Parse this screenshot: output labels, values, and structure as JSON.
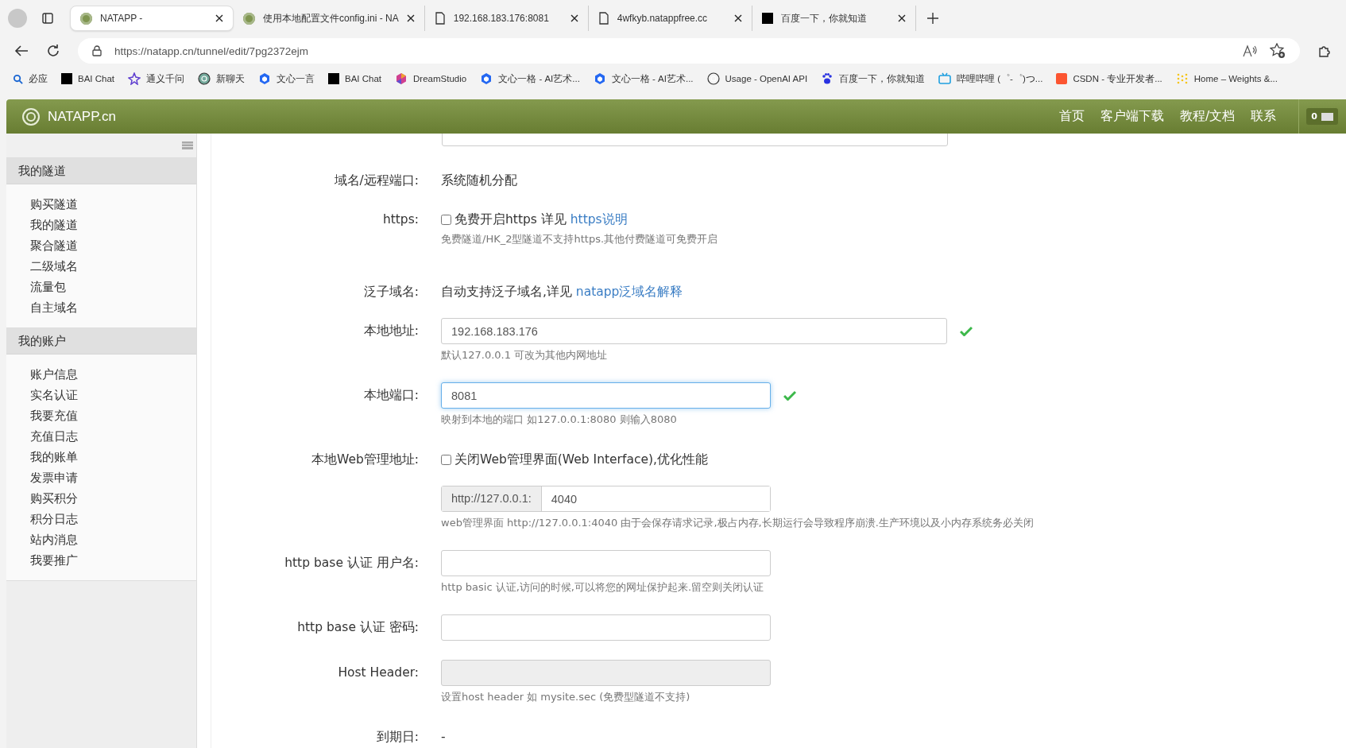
{
  "browser": {
    "tabs": [
      {
        "title": "NATAPP -",
        "selected": true
      },
      {
        "title": "使用本地配置文件config.ini - NA",
        "selected": false
      },
      {
        "title": "192.168.183.176:8081",
        "selected": false
      },
      {
        "title": "4wfkyb.natappfree.cc",
        "selected": false
      },
      {
        "title": "百度一下，你就知道",
        "selected": false
      }
    ],
    "url": "https://natapp.cn/tunnel/edit/7pg2372ejm",
    "bookmarks": [
      "必应",
      "BAI Chat",
      "通义千问",
      "新聊天",
      "文心一言",
      "BAI Chat",
      "DreamStudio",
      "文心一格 - AI艺术...",
      "文心一格 - AI艺术...",
      "Usage - OpenAI API",
      "百度一下，你就知道",
      "哔哩哔哩 (゜-゜)つ...",
      "CSDN - 专业开发者...",
      "Home – Weights &..."
    ]
  },
  "header": {
    "brand": "NATAPP.cn",
    "nav": [
      "首页",
      "客户端下载",
      "教程/文档",
      "联系"
    ],
    "mail_count": "0"
  },
  "sidebar": {
    "sections": [
      {
        "title": "我的隧道",
        "items": [
          "购买隧道",
          "我的隧道",
          "聚合隧道",
          "二级域名",
          "流量包",
          "自主域名"
        ]
      },
      {
        "title": "我的账户",
        "items": [
          "账户信息",
          "实名认证",
          "我要充值",
          "充值日志",
          "我的账单",
          "发票申请",
          "购买积分",
          "积分日志",
          "站内消息",
          "我要推广"
        ]
      }
    ]
  },
  "form": [
    {
      "kind": "text",
      "label": "域名/远程端口:",
      "text": "系统随机分配"
    },
    {
      "kind": "checkbox",
      "label": "https:",
      "text": "免费开启https 详见 ",
      "link": "https说明",
      "checked": false,
      "hint": "免费隧道/HK_2型隧道不支持https.其他付费隧道可免费开启"
    },
    {
      "kind": "text",
      "label": "泛子域名:",
      "text": "自动支持泛子域名,详见 ",
      "link": "natapp泛域名解释"
    },
    {
      "kind": "input",
      "label": "本地地址:",
      "value": "192.168.183.176",
      "valid": true,
      "hint": "默认127.0.0.1 可改为其他内网地址"
    },
    {
      "kind": "input",
      "label": "本地端口:",
      "value": "8081",
      "valid": true,
      "focused": true,
      "hint": "映射到本地的端口 如127.0.0.1:8080 则输入8080"
    },
    {
      "kind": "checkbox",
      "label": "本地Web管理地址:",
      "text": "关闭Web管理界面(Web Interface),优化性能",
      "checked": false
    },
    {
      "kind": "addon",
      "prefix": "http://127.0.0.1:",
      "value": "4040",
      "hint": "web管理界面 http://127.0.0.1:4040 由于会保存请求记录,极占内存,长期运行会导致程序崩溃.生产环境以及小内存系统务必关闭"
    },
    {
      "kind": "input",
      "label": "http base 认证 用户名:",
      "hint": "http basic 认证,访问的时候,可以将您的网址保护起来.留空则关闭认证"
    },
    {
      "kind": "input",
      "label": "http base 认证 密码:"
    },
    {
      "kind": "input",
      "label": "Host Header:",
      "disabled": true,
      "hint": "设置host header 如 mysite.sec (免费型隧道不支持)"
    },
    {
      "kind": "text",
      "label": "到期日:",
      "text": "-"
    }
  ]
}
